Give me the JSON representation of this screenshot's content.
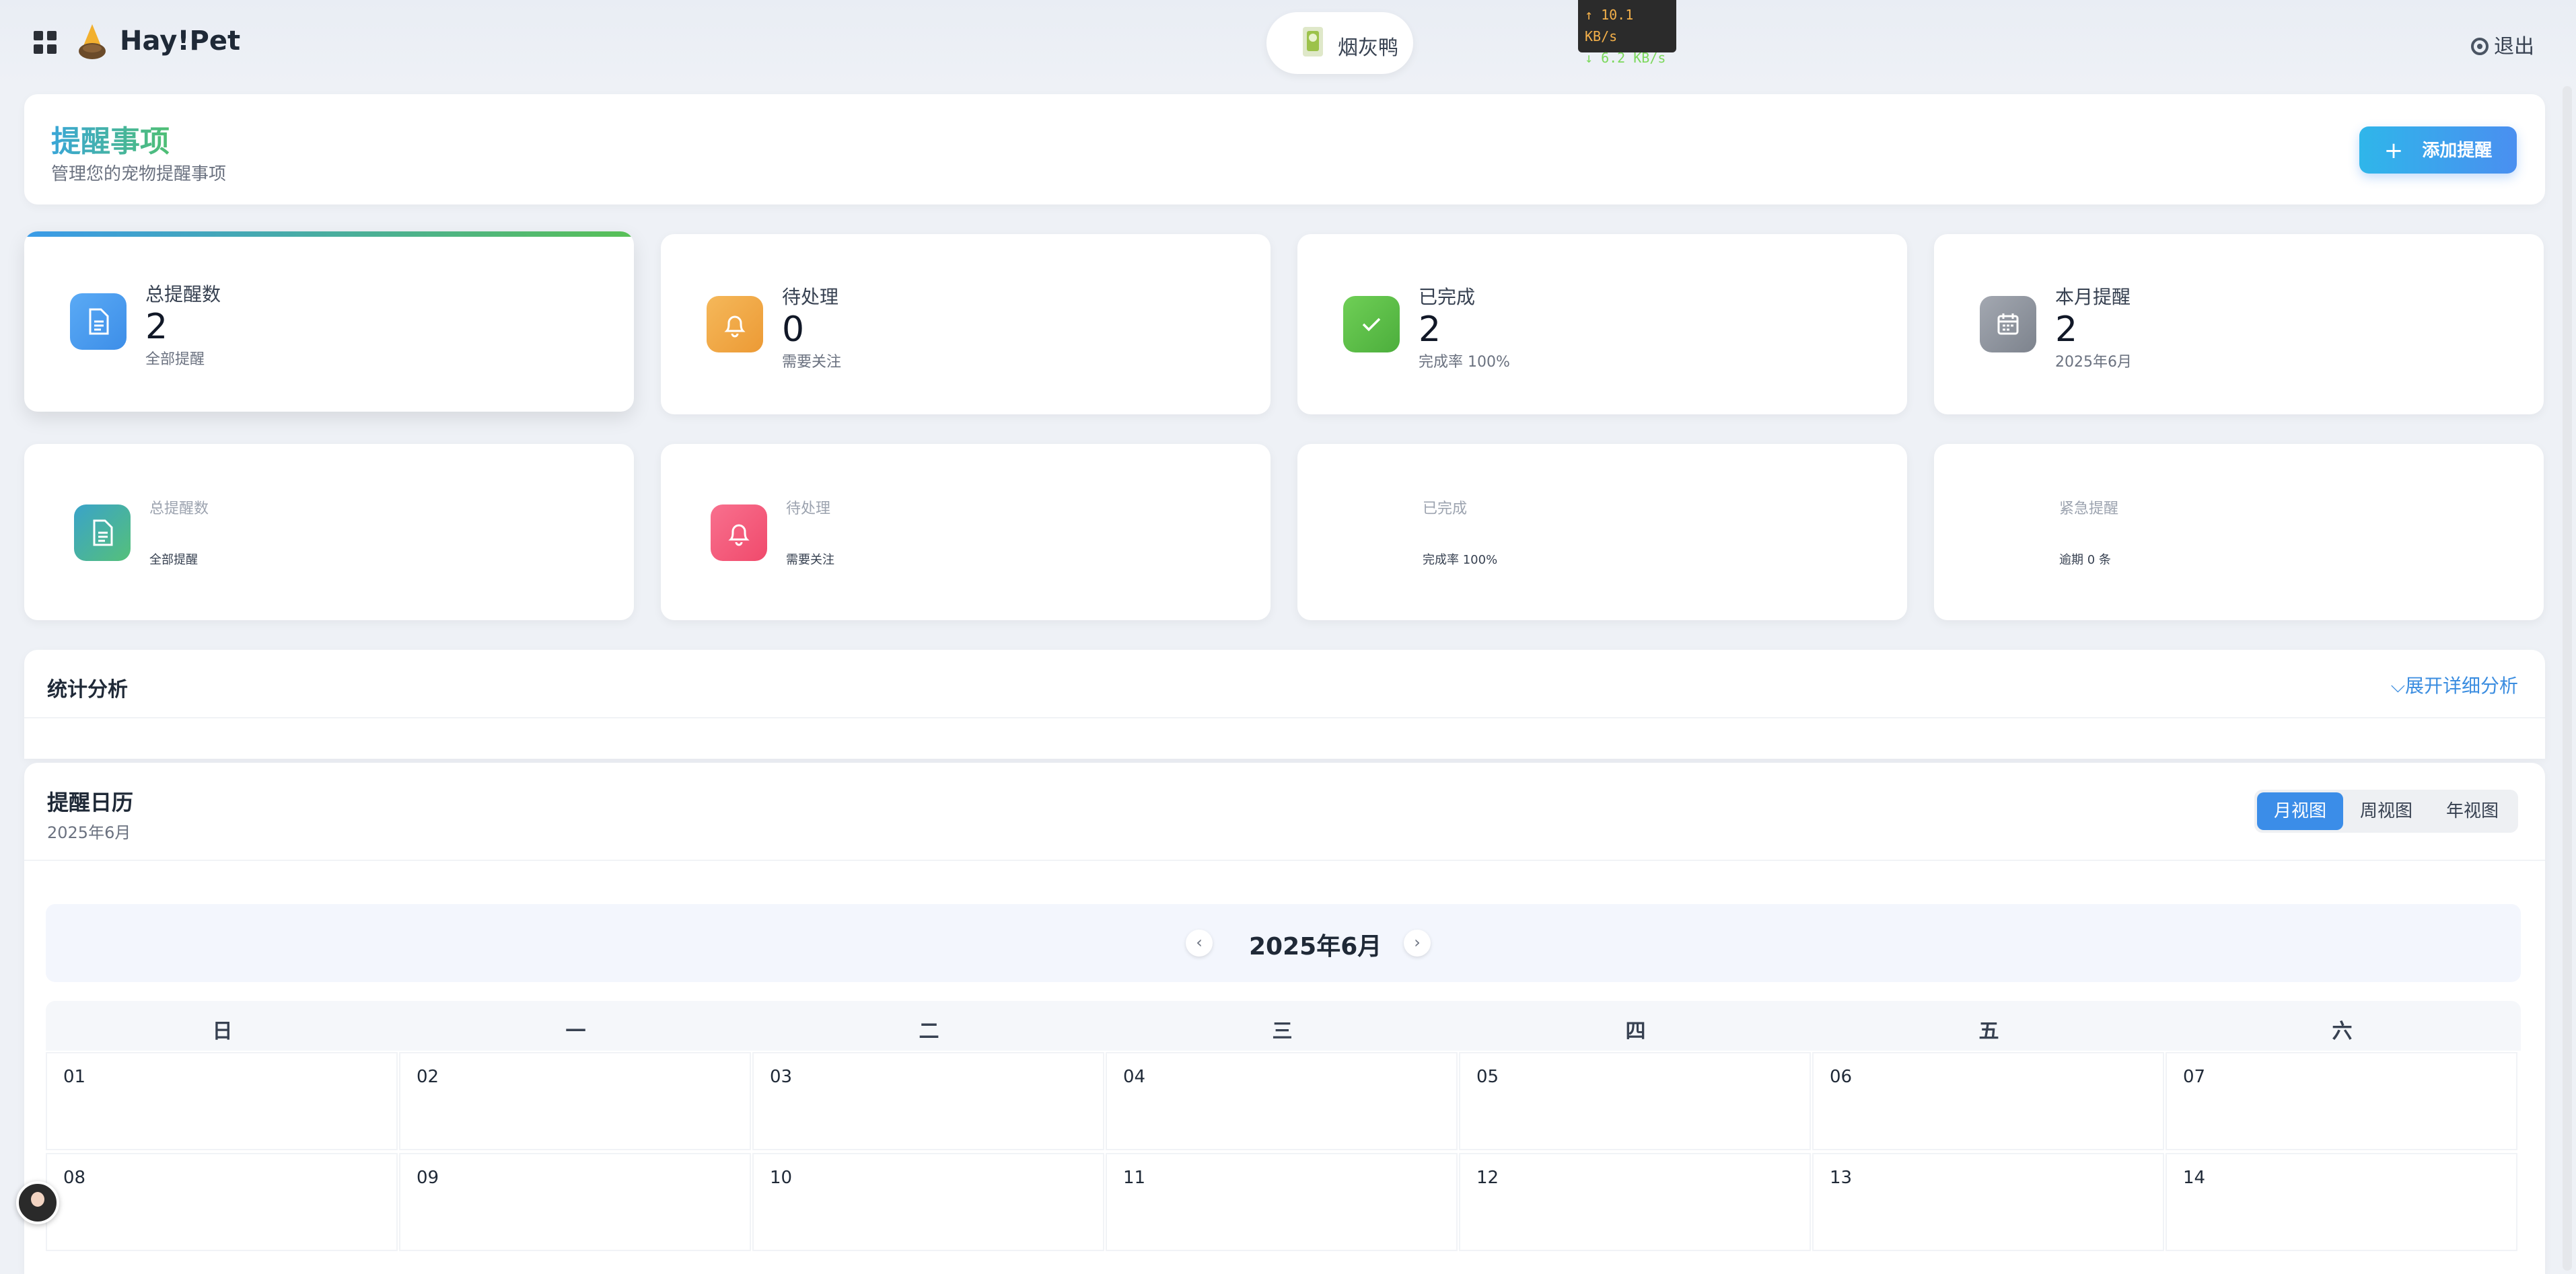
{
  "app": {
    "brand": "Hay!Pet",
    "user_name": "烟灰鸭",
    "logout_label": "退出"
  },
  "net_speed": {
    "up": "↑ 10.1 KB/s",
    "down": "↓ 6.2 KB/s"
  },
  "header": {
    "title": "提醒事项",
    "subtitle": "管理您的宠物提醒事项",
    "add_button": "添加提醒"
  },
  "stats_row1": [
    {
      "label": "总提醒数",
      "value": "2",
      "sub": "全部提醒",
      "icon": "document-icon",
      "color": "#4a9df2"
    },
    {
      "label": "待处理",
      "value": "0",
      "sub": "需要关注",
      "icon": "bell-icon",
      "color": "#f0a742"
    },
    {
      "label": "已完成",
      "value": "2",
      "sub": "完成率 100%",
      "icon": "check-icon",
      "color": "#5bbd4a"
    },
    {
      "label": "本月提醒",
      "value": "2",
      "sub": "2025年6月",
      "icon": "calendar-icon",
      "color": "#8f95a0"
    }
  ],
  "stats_row2": [
    {
      "label": "总提醒数",
      "sub": "全部提醒",
      "icon": "document-icon",
      "color": "#3aa3c9"
    },
    {
      "label": "待处理",
      "sub": "需要关注",
      "icon": "bell-icon",
      "color": "#f45c7c"
    },
    {
      "label": "已完成",
      "sub": "完成率 100%"
    },
    {
      "label": "紧急提醒",
      "sub": "逾期 0 条"
    }
  ],
  "analysis": {
    "title": "统计分析",
    "expand_label": "展开详细分析"
  },
  "calendar": {
    "title": "提醒日历",
    "subtitle": "2025年6月",
    "views": [
      "月视图",
      "周视图",
      "年视图"
    ],
    "selected_view": "月视图",
    "month_label": "2025年6月",
    "weekdays": [
      "日",
      "一",
      "二",
      "三",
      "四",
      "五",
      "六"
    ],
    "days": [
      "01",
      "02",
      "03",
      "04",
      "05",
      "06",
      "07",
      "08",
      "09",
      "10",
      "11",
      "12",
      "13",
      "14"
    ]
  }
}
